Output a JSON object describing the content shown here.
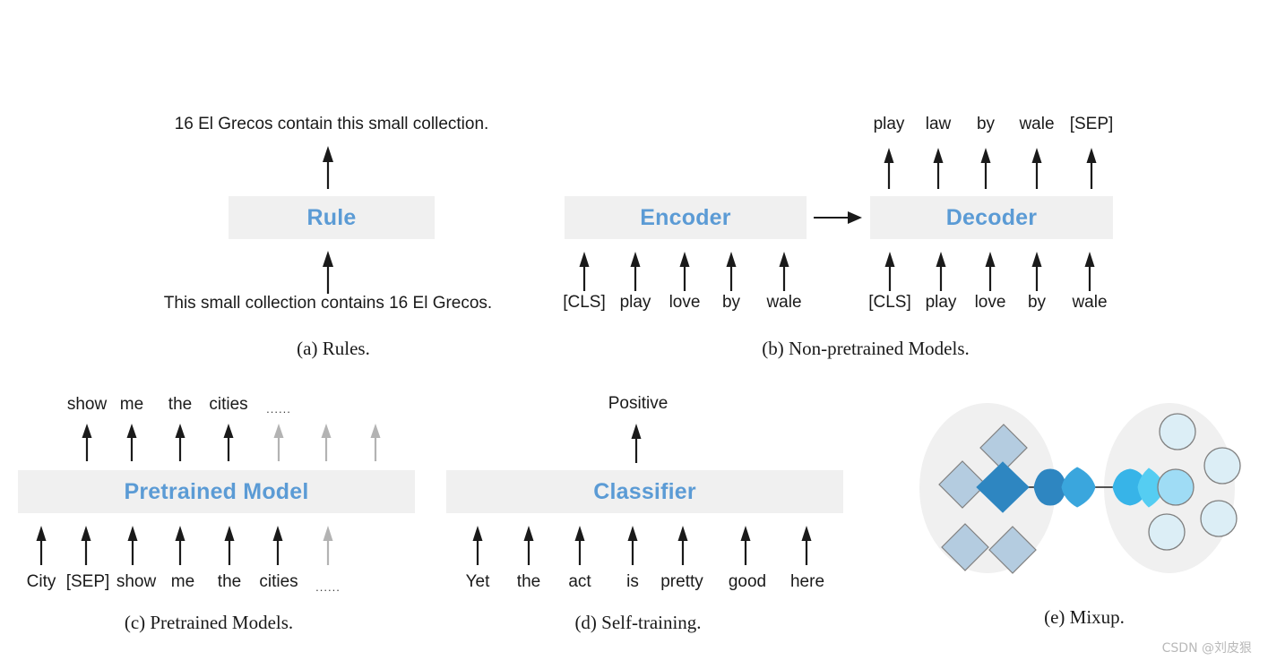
{
  "panels": {
    "a": {
      "caption": "(a) Rules.",
      "box_label": "Rule",
      "output_text": "16 El Grecos contain this small collection.",
      "input_text": "This small collection contains 16 El Grecos."
    },
    "b": {
      "caption": "(b) Non-pretrained Models.",
      "encoder_label": "Encoder",
      "decoder_label": "Decoder",
      "encoder_inputs": [
        "[CLS]",
        "play",
        "love",
        "by",
        "wale"
      ],
      "decoder_inputs": [
        "[CLS]",
        "play",
        "love",
        "by",
        "wale"
      ],
      "decoder_outputs": [
        "play",
        "law",
        "by",
        "wale",
        "[SEP]"
      ]
    },
    "c": {
      "caption": "(c) Pretrained Models.",
      "box_label": "Pretrained Model",
      "inputs": [
        "City",
        "[SEP]",
        "show",
        "me",
        "the",
        "cities",
        "......"
      ],
      "input_arrow_states": [
        "black",
        "black",
        "black",
        "black",
        "black",
        "black",
        "gray"
      ],
      "outputs": [
        "show",
        "me",
        "the",
        "cities",
        "......"
      ],
      "output_arrow_states": [
        "black",
        "black",
        "black",
        "black",
        "gray",
        "gray",
        "gray"
      ]
    },
    "d": {
      "caption": "(d) Self-training.",
      "box_label": "Classifier",
      "output_label": "Positive",
      "inputs": [
        "Yet",
        "the",
        "act",
        "is",
        "pretty",
        "good",
        "here"
      ]
    },
    "e": {
      "caption": "(e) Mixup.",
      "left_cluster_shape": "diamond",
      "right_cluster_shape": "circle",
      "left_cluster_count": 5,
      "right_cluster_count": 5,
      "interpolation_steps": 4
    }
  },
  "colors": {
    "accent_blue": "#5b9bd5",
    "box_fill": "#f0f0f0",
    "arrow_black": "#1a1a1a",
    "arrow_gray": "#b3b3b3",
    "ellipse_fill": "#f0f0f0",
    "diamond_light": "#b4cce0",
    "diamond_dark": "#2e86c1",
    "circle_light": "#dceef6",
    "circle_highlight": "#9fdcf5",
    "mix_mid_a": "#2e86c1",
    "mix_mid_b": "#3aa6dd",
    "mix_mid_c": "#37b4e8",
    "mix_mid_d": "#55cdf2",
    "shape_stroke": "#808080",
    "connector": "#3b3b3b"
  },
  "watermark": "CSDN @刘皮狠"
}
